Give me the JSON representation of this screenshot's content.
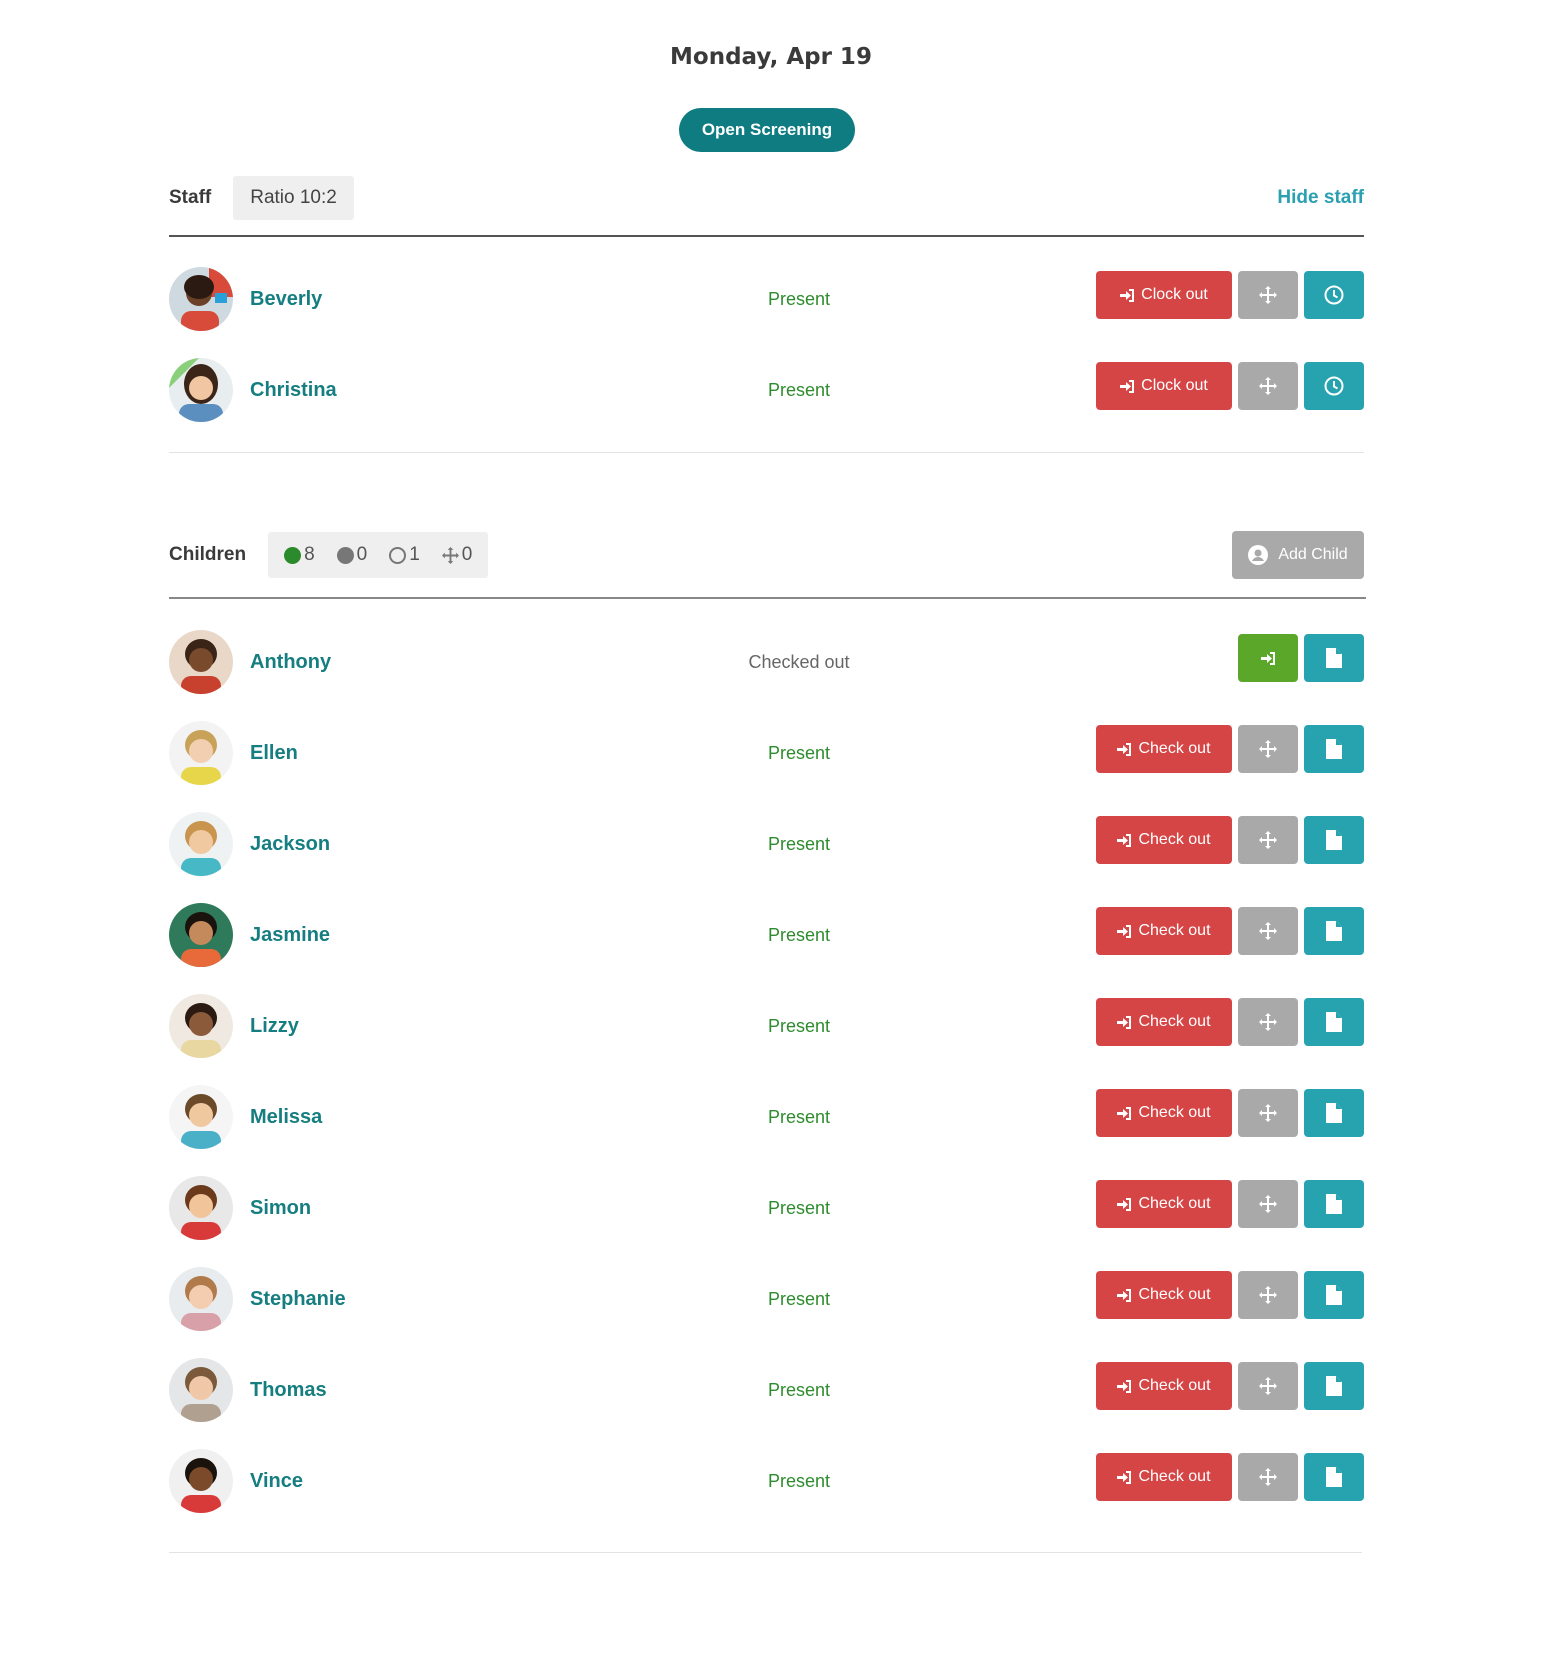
{
  "header": {
    "date": "Monday, Apr 19",
    "screening_button": "Open Screening"
  },
  "staff": {
    "label": "Staff",
    "ratio": "Ratio 10:2",
    "hide_label": "Hide staff",
    "members": [
      {
        "name": "Beverly",
        "status": "Present",
        "action": "Clock out"
      },
      {
        "name": "Christina",
        "status": "Present",
        "action": "Clock out"
      }
    ]
  },
  "children": {
    "label": "Children",
    "counts": {
      "present": "8",
      "absent": "0",
      "expected": "1",
      "moved": "0"
    },
    "add_label": "Add Child",
    "list": [
      {
        "name": "Anthony",
        "status": "Checked out",
        "action": ""
      },
      {
        "name": "Ellen",
        "status": "Present",
        "action": "Check out"
      },
      {
        "name": "Jackson",
        "status": "Present",
        "action": "Check out"
      },
      {
        "name": "Jasmine",
        "status": "Present",
        "action": "Check out"
      },
      {
        "name": "Lizzy",
        "status": "Present",
        "action": "Check out"
      },
      {
        "name": "Melissa",
        "status": "Present",
        "action": "Check out"
      },
      {
        "name": "Simon",
        "status": "Present",
        "action": "Check out"
      },
      {
        "name": "Stephanie",
        "status": "Present",
        "action": "Check out"
      },
      {
        "name": "Thomas",
        "status": "Present",
        "action": "Check out"
      },
      {
        "name": "Vince",
        "status": "Present",
        "action": "Check out"
      }
    ]
  },
  "icons": {
    "sign_in": "sign-in-icon",
    "move": "move-icon",
    "clock": "clock-icon",
    "document": "document-icon",
    "user": "user-circle-icon"
  },
  "colors": {
    "brand_teal": "#0e7c80",
    "name_teal": "#167e80",
    "action_teal": "#27a3b0",
    "danger": "#d64545",
    "neutral": "#a9a9a9",
    "success": "#5aa72a",
    "present_green": "#2e8b2e"
  }
}
